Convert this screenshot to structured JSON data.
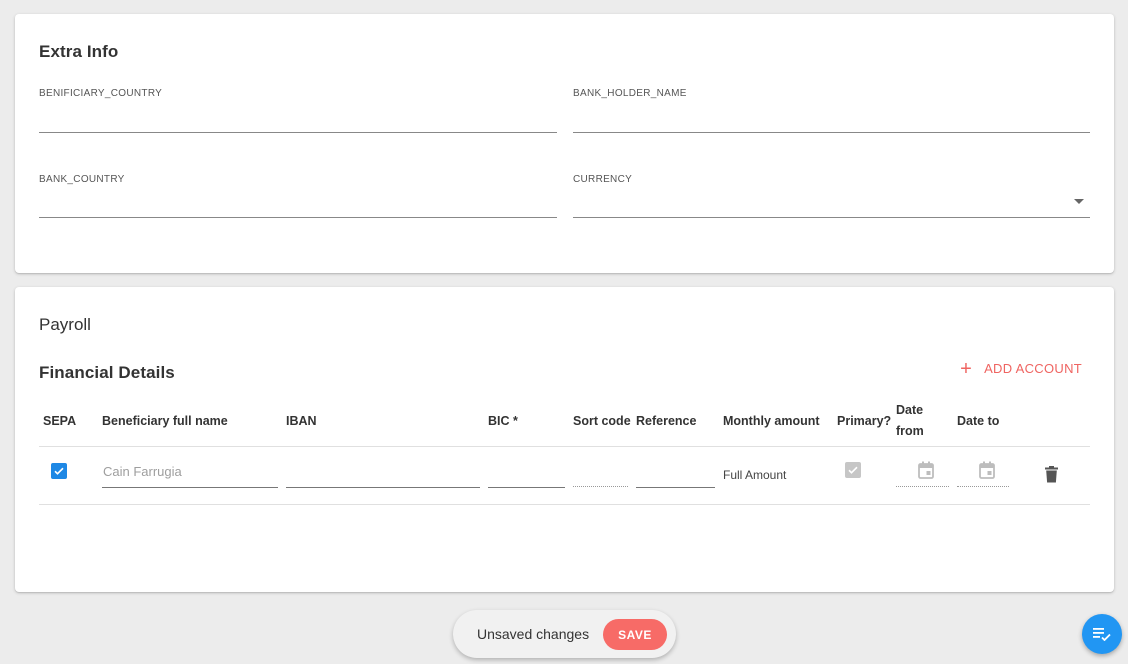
{
  "extra_info": {
    "title": "Extra Info",
    "fields": {
      "beneficiary_country": {
        "label": "BENIFICIARY_COUNTRY",
        "value": ""
      },
      "bank_holder_name": {
        "label": "BANK_HOLDER_NAME",
        "value": ""
      },
      "bank_country": {
        "label": "BANK_COUNTRY",
        "value": ""
      },
      "currency": {
        "label": "CURRENCY",
        "value": ""
      }
    }
  },
  "payroll": {
    "title": "Payroll",
    "financial_details": {
      "title": "Financial Details",
      "add_account_label": "ADD ACCOUNT",
      "columns": {
        "sepa": "SEPA",
        "beneficiary": "Beneficiary full name",
        "iban": "IBAN",
        "bic": "BIC *",
        "sort_code": "Sort code",
        "reference": "Reference",
        "monthly_amount": "Monthly amount",
        "primary": "Primary?",
        "date_from_1": "Date",
        "date_from_2": "from",
        "date_to": "Date to"
      },
      "rows": [
        {
          "sepa": true,
          "beneficiary_placeholder": "Cain Farrugia",
          "iban": "",
          "bic": "",
          "sort_code": "",
          "reference": "",
          "monthly_amount": "Full Amount",
          "primary": true,
          "date_from": "",
          "date_to": ""
        }
      ]
    }
  },
  "save_bar": {
    "message": "Unsaved changes",
    "save_label": "SAVE"
  },
  "icons": {
    "add": "plus-icon",
    "dropdown": "chevron-down-icon",
    "calendar": "calendar-icon",
    "delete": "trash-icon",
    "fab": "playlist-check-icon"
  },
  "colors": {
    "accent": "#ef6461",
    "checkbox": "#1e88e5",
    "fab": "#2196f3",
    "save_button": "#f76b67"
  }
}
